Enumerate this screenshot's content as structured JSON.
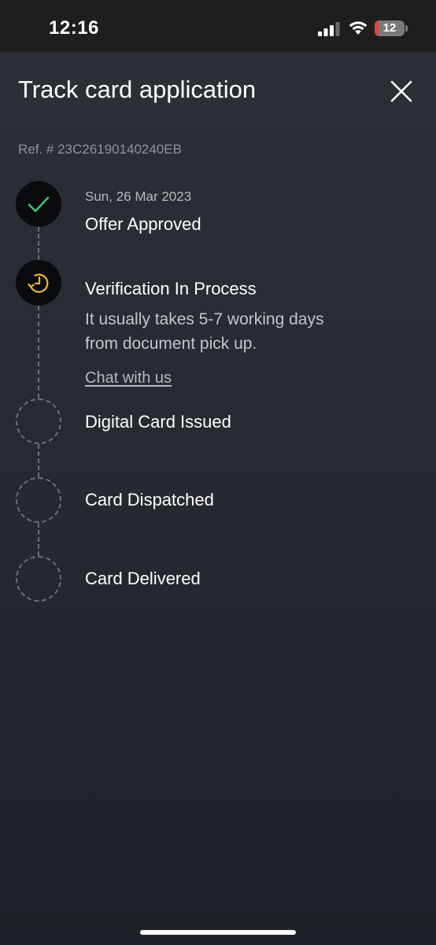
{
  "status_bar": {
    "time": "12:16",
    "battery_level": "12",
    "battery_fraction": 0.12,
    "battery_color": "#e5453c"
  },
  "header": {
    "title": "Track card application",
    "close_icon": "close-icon"
  },
  "reference": {
    "text": "Ref. # 23C26190140240EB"
  },
  "steps": [
    {
      "status": "done",
      "icon": "checkmark-icon",
      "date": "Sun, 26 Mar 2023",
      "title": "Offer Approved"
    },
    {
      "status": "in-progress",
      "icon": "clock-icon",
      "title": "Verification In Process",
      "description_line1": "It usually takes 5-7 working days",
      "description_line2": "from document pick up.",
      "link": "Chat with us"
    },
    {
      "status": "pending",
      "title": "Digital Card Issued"
    },
    {
      "status": "pending",
      "title": "Card Dispatched"
    },
    {
      "status": "pending",
      "title": "Card Delivered"
    }
  ],
  "colors": {
    "check_green": "#3cc26b",
    "clock_yellow": "#f2b632"
  }
}
